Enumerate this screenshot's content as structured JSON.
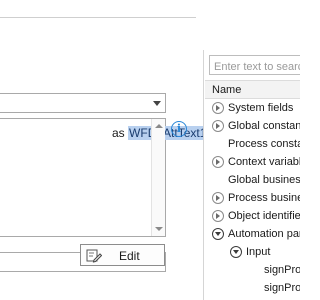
{
  "editor": {
    "expression_prefix": "as",
    "expression_token": "WFD_AttText1",
    "edit_button_label": "Edit"
  },
  "fields_panel": {
    "search_placeholder": "Enter text to search",
    "column_header": "Name",
    "tree": [
      {
        "label": "System fields",
        "level": 0,
        "expander": "collapsed"
      },
      {
        "label": "Global constants",
        "level": 0,
        "expander": "collapsed"
      },
      {
        "label": "Process constants",
        "level": 0,
        "expander": "none"
      },
      {
        "label": "Context variables",
        "level": 0,
        "expander": "collapsed"
      },
      {
        "label": "Global business rules",
        "level": 0,
        "expander": "none"
      },
      {
        "label": "Process business rules",
        "level": 0,
        "expander": "collapsed"
      },
      {
        "label": "Object identifiers",
        "level": 0,
        "expander": "collapsed"
      },
      {
        "label": "Automation parameters",
        "level": 0,
        "expander": "expanded"
      },
      {
        "label": "Input",
        "level": 1,
        "expander": "expanded"
      },
      {
        "label": "signProcess",
        "level": 2,
        "expander": "none"
      },
      {
        "label": "signProcess",
        "level": 2,
        "expander": "none"
      }
    ]
  },
  "colors": {
    "selection_bg": "#b8d0ef",
    "info_accent": "#2b88d8",
    "border": "#a9a9a9"
  },
  "icons": {
    "info": "info-icon",
    "edit": "edit-icon",
    "dropdown": "chevron-down-icon",
    "tree_expander": "circle-arrow-icon"
  }
}
